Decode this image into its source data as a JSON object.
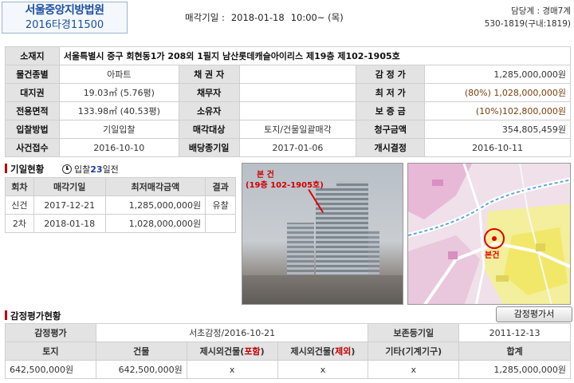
{
  "header": {
    "court": "서울중앙지방법원",
    "case_no": "2016타경11500",
    "sale_date_label": "매각기일 :",
    "sale_date": "2018-01-18",
    "sale_time": "10:00~ (목)",
    "manager": "담당계 : 경매7계",
    "phone": "530-1819(구내:1819)"
  },
  "info": {
    "address_label": "소재지",
    "address": "서울특별시 중구 회현동1가 208외 1필지 남산롯데캐슬아이리스 제19층 제102-1905호",
    "type_label": "물건종별",
    "type": "아파트",
    "creditor_label": "채 권 자",
    "creditor": "",
    "appraisal_label": "감 정 가",
    "appraisal": "1,285,000,000원",
    "land_label": "대지권",
    "land": "19.03㎡ (5.76평)",
    "debtor_label": "채무자",
    "debtor": "",
    "minimum_label": "최 저 가",
    "minimum_pct": "(80%)",
    "minimum": "1,028,000,000원",
    "area_label": "전용면적",
    "area": "133.98㎡ (40.53평)",
    "owner_label": "소유자",
    "owner": "",
    "deposit_label": "보 증 금",
    "deposit": "(10%)102,800,000원",
    "method_label": "입찰방법",
    "method": "기일입찰",
    "target_label": "매각대상",
    "target": "토지/건물일괄매각",
    "claim_label": "청구금액",
    "claim": "354,805,459원",
    "received_label": "사건접수",
    "received": "2016-10-10",
    "dividend_label": "배당종기일",
    "dividend": "2017-01-06",
    "start_label": "개시결정",
    "start": "2016-10-11"
  },
  "bidding": {
    "title": "기일현황",
    "today_prefix": "입찰",
    "today_days": "23",
    "today_suffix": "일전",
    "headers": [
      "회차",
      "매각기일",
      "최저매각금액",
      "결과"
    ],
    "rows": [
      {
        "round": "신건",
        "date": "2017-12-21",
        "price": "1,285,000,000원",
        "result": "유찰"
      },
      {
        "round": "2차",
        "date": "2018-01-18",
        "price": "1,028,000,000원",
        "result": ""
      }
    ]
  },
  "photo": {
    "caption_line1": "본 건",
    "caption_line2": "(19층 102-1905호)"
  },
  "map": {
    "marker_label": "본건"
  },
  "appraisal": {
    "title": "감정평가현황",
    "button": "감정평가서",
    "agency_label": "감정평가",
    "agency": "서초감정/2016-10-21",
    "retention_label": "보존등기일",
    "retention": "2011-12-13",
    "headers": [
      "토지",
      "건물",
      "제시외건물(포함)",
      "제시외건물(제외)",
      "기타(기계기구)",
      "합계"
    ],
    "h3_a": "제시외건물(",
    "h3_b": "포함",
    "h3_c": ")",
    "h4_a": "제시외건물(",
    "h4_b": "제외",
    "h4_c": ")",
    "values": [
      "642,500,000원",
      "642,500,000원",
      "x",
      "x",
      "x",
      "1,285,000,000원"
    ]
  }
}
